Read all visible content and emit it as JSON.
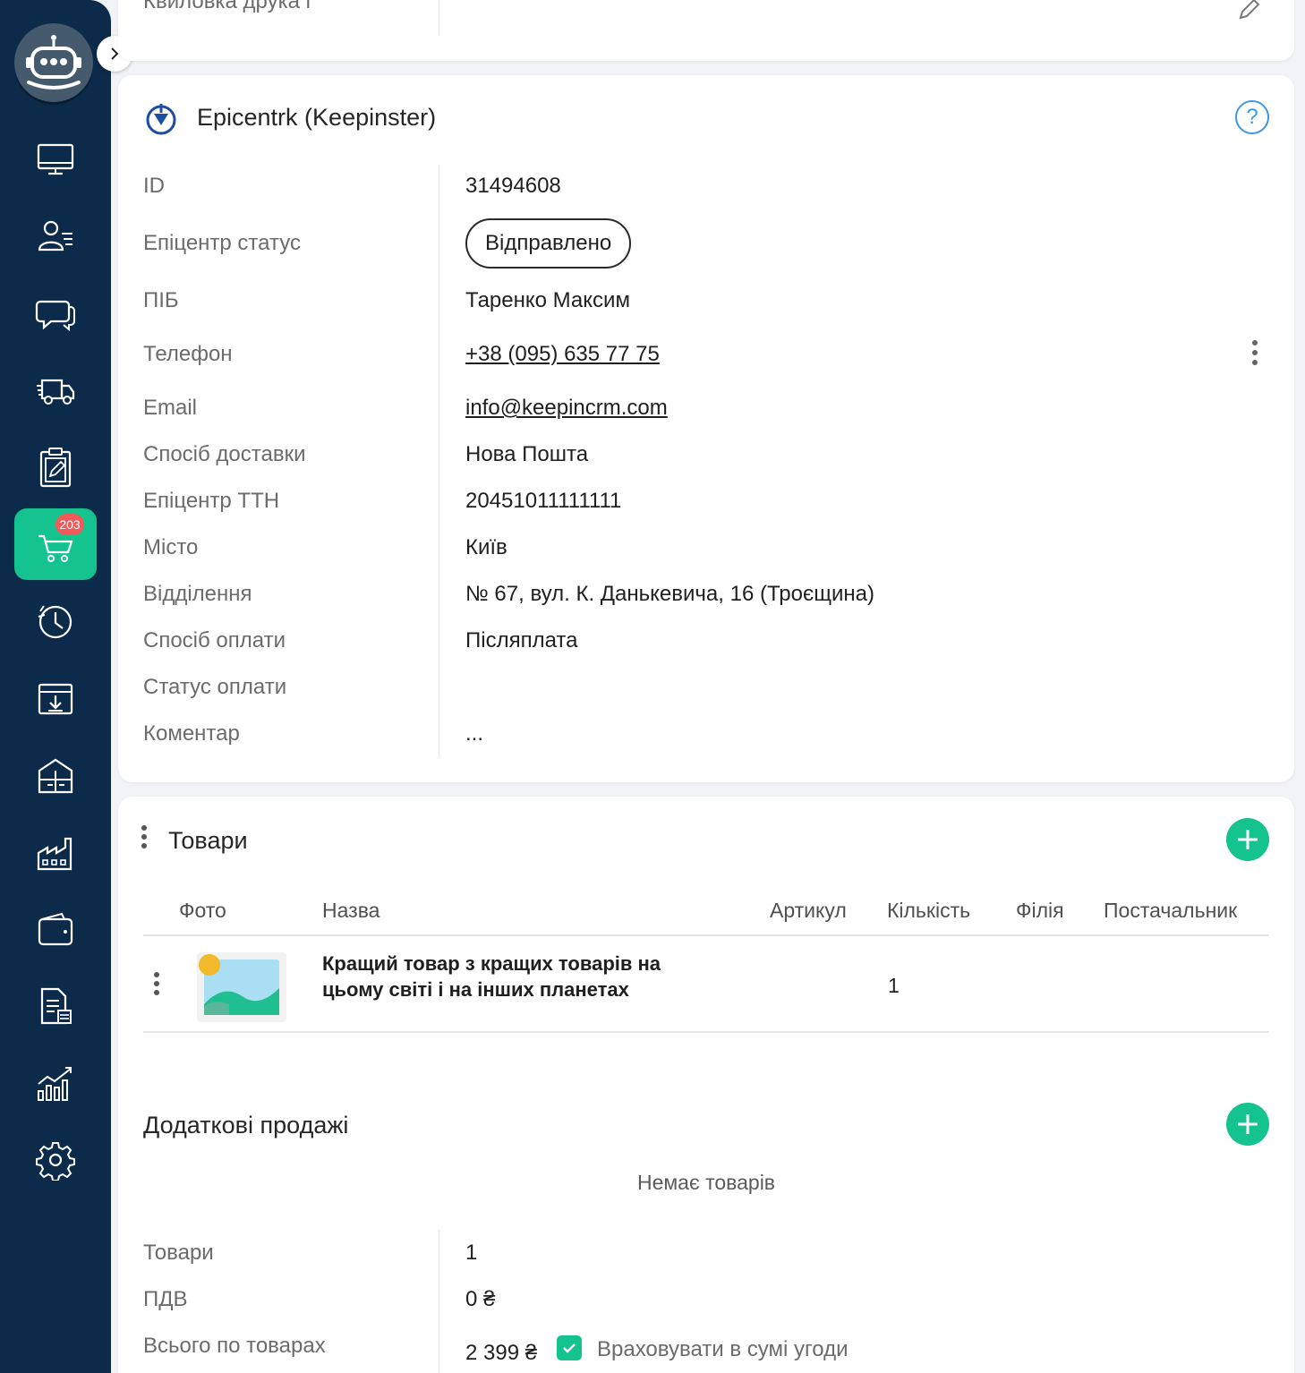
{
  "sidebar": {
    "cart_badge": "203",
    "items": [
      {
        "name": "monitor-icon"
      },
      {
        "name": "contacts-icon"
      },
      {
        "name": "chat-icon"
      },
      {
        "name": "delivery-truck-icon"
      },
      {
        "name": "clipboard-icon"
      },
      {
        "name": "cart-icon"
      },
      {
        "name": "clock-icon"
      },
      {
        "name": "inbox-download-icon"
      },
      {
        "name": "warehouse-icon"
      },
      {
        "name": "factory-icon"
      },
      {
        "name": "wallet-icon"
      },
      {
        "name": "document-icon"
      },
      {
        "name": "analytics-icon"
      },
      {
        "name": "settings-icon"
      }
    ]
  },
  "top_fragment": {
    "label": "Квиловка друка і"
  },
  "epicentr": {
    "title": "Epicentrk (Keepinster)",
    "rows": {
      "id_label": "ID",
      "id_value": "31494608",
      "status_label": "Епіцентр статус",
      "status_value": "Відправлено",
      "name_label": "ПІБ",
      "name_value": "Таренко Максим",
      "phone_label": "Телефон",
      "phone_value": "+38 (095) 635 77 75",
      "email_label": "Email",
      "email_value": "info@keepincrm.com",
      "delivery_label": "Спосіб доставки",
      "delivery_value": "Нова Пошта",
      "ttn_label": "Епіцентр ТТН",
      "ttn_value": "20451011111111",
      "city_label": "Місто",
      "city_value": "Київ",
      "branch_label": "Відділення",
      "branch_value": "№ 67, вул. К. Данькевича, 16 (Троєщина)",
      "payment_label": "Спосіб оплати",
      "payment_value": "Післяплата",
      "pay_status_label": "Статус оплати",
      "pay_status_value": "",
      "comment_label": "Коментар",
      "comment_value": "..."
    }
  },
  "goods": {
    "title": "Товари",
    "columns": [
      "Фото",
      "Назва",
      "Артикул",
      "Кількість",
      "Філія",
      "Постачальник"
    ],
    "items": [
      {
        "name": "Кращий товар з кращих товарів на цьому світі і на інших планетах",
        "sku": "",
        "qty": "1",
        "branch": "",
        "supplier": ""
      }
    ],
    "extra_title": "Додаткові продажі",
    "extra_empty": "Немає товарів",
    "summary": {
      "goods_label": "Товари",
      "goods_value": "1",
      "vat_label": "ПДВ",
      "vat_value": "0 ₴",
      "total_label": "Всього по товарах",
      "total_value": "2 399 ₴",
      "include_label": "Враховувати в сумі угоди",
      "include_checked": true
    }
  },
  "colors": {
    "sidebar_bg": "#0c2b4b",
    "accent": "#14c38e",
    "badge": "#f25a5a",
    "help": "#3d98e6"
  }
}
